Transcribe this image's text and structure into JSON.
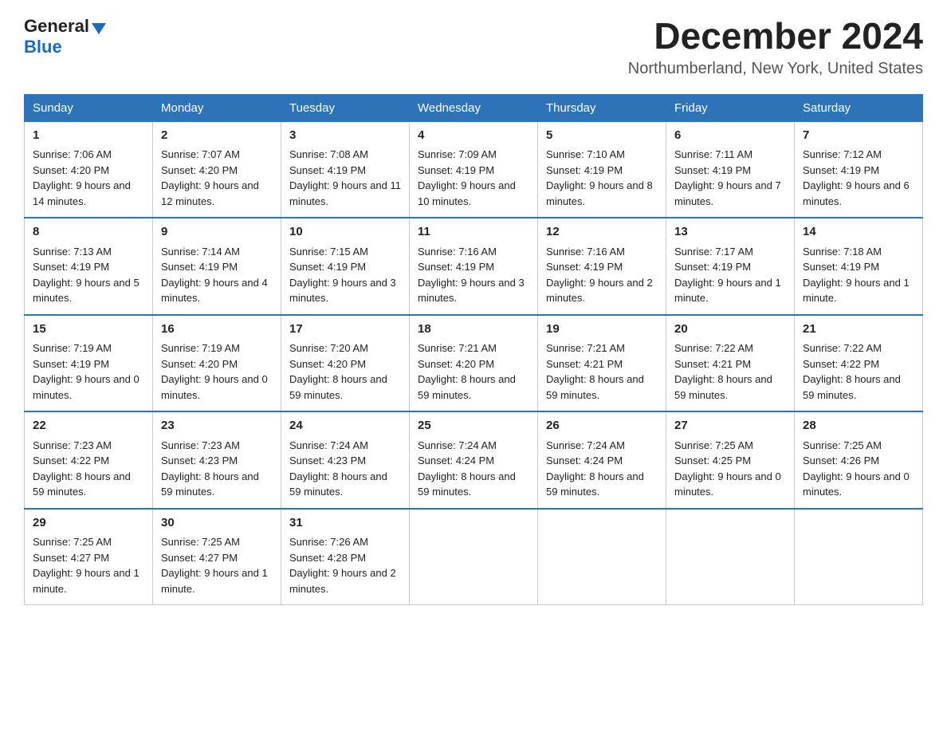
{
  "header": {
    "logo_general": "General",
    "logo_blue": "Blue",
    "month_title": "December 2024",
    "location": "Northumberland, New York, United States"
  },
  "weekdays": [
    "Sunday",
    "Monday",
    "Tuesday",
    "Wednesday",
    "Thursday",
    "Friday",
    "Saturday"
  ],
  "weeks": [
    [
      {
        "day": "1",
        "sunrise": "7:06 AM",
        "sunset": "4:20 PM",
        "daylight": "9 hours and 14 minutes."
      },
      {
        "day": "2",
        "sunrise": "7:07 AM",
        "sunset": "4:20 PM",
        "daylight": "9 hours and 12 minutes."
      },
      {
        "day": "3",
        "sunrise": "7:08 AM",
        "sunset": "4:19 PM",
        "daylight": "9 hours and 11 minutes."
      },
      {
        "day": "4",
        "sunrise": "7:09 AM",
        "sunset": "4:19 PM",
        "daylight": "9 hours and 10 minutes."
      },
      {
        "day": "5",
        "sunrise": "7:10 AM",
        "sunset": "4:19 PM",
        "daylight": "9 hours and 8 minutes."
      },
      {
        "day": "6",
        "sunrise": "7:11 AM",
        "sunset": "4:19 PM",
        "daylight": "9 hours and 7 minutes."
      },
      {
        "day": "7",
        "sunrise": "7:12 AM",
        "sunset": "4:19 PM",
        "daylight": "9 hours and 6 minutes."
      }
    ],
    [
      {
        "day": "8",
        "sunrise": "7:13 AM",
        "sunset": "4:19 PM",
        "daylight": "9 hours and 5 minutes."
      },
      {
        "day": "9",
        "sunrise": "7:14 AM",
        "sunset": "4:19 PM",
        "daylight": "9 hours and 4 minutes."
      },
      {
        "day": "10",
        "sunrise": "7:15 AM",
        "sunset": "4:19 PM",
        "daylight": "9 hours and 3 minutes."
      },
      {
        "day": "11",
        "sunrise": "7:16 AM",
        "sunset": "4:19 PM",
        "daylight": "9 hours and 3 minutes."
      },
      {
        "day": "12",
        "sunrise": "7:16 AM",
        "sunset": "4:19 PM",
        "daylight": "9 hours and 2 minutes."
      },
      {
        "day": "13",
        "sunrise": "7:17 AM",
        "sunset": "4:19 PM",
        "daylight": "9 hours and 1 minute."
      },
      {
        "day": "14",
        "sunrise": "7:18 AM",
        "sunset": "4:19 PM",
        "daylight": "9 hours and 1 minute."
      }
    ],
    [
      {
        "day": "15",
        "sunrise": "7:19 AM",
        "sunset": "4:19 PM",
        "daylight": "9 hours and 0 minutes."
      },
      {
        "day": "16",
        "sunrise": "7:19 AM",
        "sunset": "4:20 PM",
        "daylight": "9 hours and 0 minutes."
      },
      {
        "day": "17",
        "sunrise": "7:20 AM",
        "sunset": "4:20 PM",
        "daylight": "8 hours and 59 minutes."
      },
      {
        "day": "18",
        "sunrise": "7:21 AM",
        "sunset": "4:20 PM",
        "daylight": "8 hours and 59 minutes."
      },
      {
        "day": "19",
        "sunrise": "7:21 AM",
        "sunset": "4:21 PM",
        "daylight": "8 hours and 59 minutes."
      },
      {
        "day": "20",
        "sunrise": "7:22 AM",
        "sunset": "4:21 PM",
        "daylight": "8 hours and 59 minutes."
      },
      {
        "day": "21",
        "sunrise": "7:22 AM",
        "sunset": "4:22 PM",
        "daylight": "8 hours and 59 minutes."
      }
    ],
    [
      {
        "day": "22",
        "sunrise": "7:23 AM",
        "sunset": "4:22 PM",
        "daylight": "8 hours and 59 minutes."
      },
      {
        "day": "23",
        "sunrise": "7:23 AM",
        "sunset": "4:23 PM",
        "daylight": "8 hours and 59 minutes."
      },
      {
        "day": "24",
        "sunrise": "7:24 AM",
        "sunset": "4:23 PM",
        "daylight": "8 hours and 59 minutes."
      },
      {
        "day": "25",
        "sunrise": "7:24 AM",
        "sunset": "4:24 PM",
        "daylight": "8 hours and 59 minutes."
      },
      {
        "day": "26",
        "sunrise": "7:24 AM",
        "sunset": "4:24 PM",
        "daylight": "8 hours and 59 minutes."
      },
      {
        "day": "27",
        "sunrise": "7:25 AM",
        "sunset": "4:25 PM",
        "daylight": "9 hours and 0 minutes."
      },
      {
        "day": "28",
        "sunrise": "7:25 AM",
        "sunset": "4:26 PM",
        "daylight": "9 hours and 0 minutes."
      }
    ],
    [
      {
        "day": "29",
        "sunrise": "7:25 AM",
        "sunset": "4:27 PM",
        "daylight": "9 hours and 1 minute."
      },
      {
        "day": "30",
        "sunrise": "7:25 AM",
        "sunset": "4:27 PM",
        "daylight": "9 hours and 1 minute."
      },
      {
        "day": "31",
        "sunrise": "7:26 AM",
        "sunset": "4:28 PM",
        "daylight": "9 hours and 2 minutes."
      },
      null,
      null,
      null,
      null
    ]
  ],
  "labels": {
    "sunrise": "Sunrise:",
    "sunset": "Sunset:",
    "daylight": "Daylight:"
  }
}
